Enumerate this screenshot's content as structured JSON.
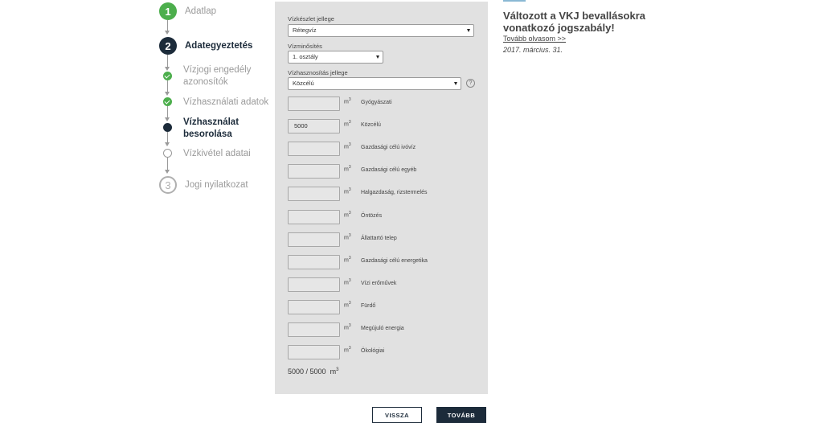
{
  "stepper": {
    "steps": [
      {
        "number": "1",
        "label": "Adatlap",
        "state": "done"
      },
      {
        "number": "2",
        "label": "Adategyeztetés",
        "state": "active"
      },
      {
        "label": "Vízjogi engedély azonosítók",
        "state": "done-sub"
      },
      {
        "label": "Vízhasználati adatok",
        "state": "done-sub"
      },
      {
        "label": "Vízhasználat besorolása",
        "state": "active-sub"
      },
      {
        "label": "Vízkivétel adatai",
        "state": "todo-sub"
      },
      {
        "number": "3",
        "label": "Jogi nyilatkozat",
        "state": "todo"
      }
    ],
    "sub_labels": {
      "s0_line1": "Vízjogi engedély",
      "s0_line2": "azonosítók",
      "s2_line1": "Vízhasználat",
      "s2_line2": "besorolása"
    }
  },
  "form": {
    "vizkeszlet": {
      "label": "Vízkészlet jellege",
      "value": "Rétegvíz"
    },
    "vizminosites": {
      "label": "Vízminősítés",
      "value": "1. osztály"
    },
    "vizhasznositas": {
      "label": "Vízhasznosítás jellege",
      "value": "Közcélú"
    },
    "help_icon": "?",
    "unit": "m",
    "unit_sup": "3",
    "rows": [
      {
        "name": "Gyógyászati",
        "value": ""
      },
      {
        "name": "Közcélú",
        "value": "5000"
      },
      {
        "name": "Gazdasági célú ivóvíz",
        "value": ""
      },
      {
        "name": "Gazdasági célú egyéb",
        "value": ""
      },
      {
        "name": "Halgazdaság, rizstermelés",
        "value": ""
      },
      {
        "name": "Öntözés",
        "value": ""
      },
      {
        "name": "Állattartó telep",
        "value": ""
      },
      {
        "name": "Gazdasági célú energetika",
        "value": ""
      },
      {
        "name": "Vízi erőművek",
        "value": ""
      },
      {
        "name": "Fürdő",
        "value": ""
      },
      {
        "name": "Megújuló energia",
        "value": ""
      },
      {
        "name": "Ökológiai",
        "value": ""
      }
    ],
    "total": "5000 / 5000",
    "total_unit": "m",
    "total_sup": "3"
  },
  "buttons": {
    "back": "VISSZA",
    "next": "TOVÁBB"
  },
  "news": {
    "title": "Változott a VKJ bevallásokra vonatkozó jogszabály!",
    "link": "Tovább olvasom >>",
    "date": "2017. március. 31."
  },
  "colors": {
    "accent_dark": "#1c2b3a",
    "done_green": "#4cae4c",
    "panel_bg": "#e1e1e1"
  }
}
